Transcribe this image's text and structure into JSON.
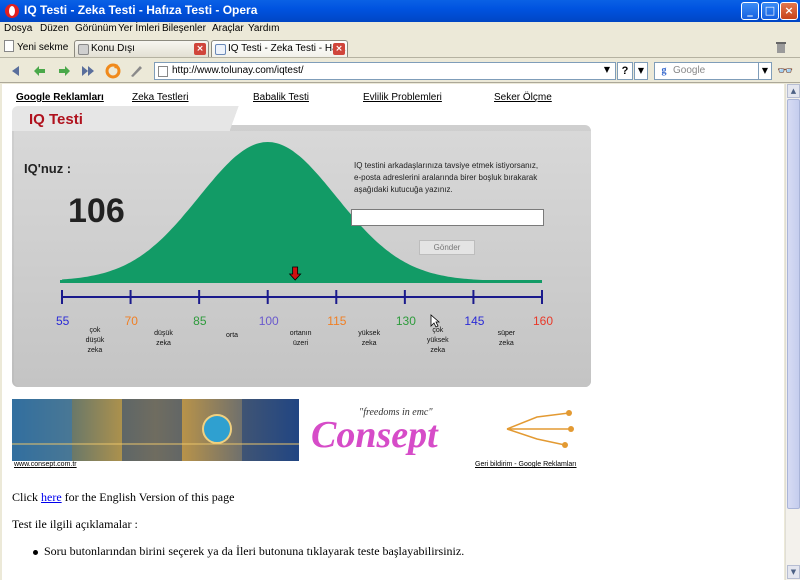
{
  "window": {
    "title": "IQ Testi - Zeka Testi - Hafıza Testi - Opera"
  },
  "menu": [
    "Dosya",
    "Düzen",
    "Görünüm",
    "Yer İmleri",
    "Bileşenler",
    "Araçlar",
    "Yardım"
  ],
  "tabs": {
    "new_tab": "Yeni sekme",
    "items": [
      {
        "label": "Konu Dışı"
      },
      {
        "label": "IQ Testi - Zeka Testi - Ha..."
      }
    ]
  },
  "address": {
    "url": "http://www.tolunay.com/iqtest/",
    "search_placeholder": "Google"
  },
  "page": {
    "nav_links": [
      "Google Reklamları",
      "Zeka Testleri",
      "Babalik Testi",
      "Evlilik Problemleri",
      "Seker Ölçme"
    ],
    "panel_title": "IQ Testi",
    "iq_label": "IQ'nuz :",
    "iq_score": "106",
    "invite_text": "IQ testini arkadaşlarınıza tavsiye etmek istiyorsanız, e-posta adreslerini aralarında birer boşluk bırakarak aşağıdaki kutucuğa yazınız.",
    "send_button": "Gönder",
    "scale": [
      {
        "value": "55",
        "color": "#2b2bd6",
        "caption": "çok\ndüşük\nzeka"
      },
      {
        "value": "70",
        "color": "#f07f24",
        "caption": "düşük\nzeka"
      },
      {
        "value": "85",
        "color": "#2e9b3c",
        "caption": "orta"
      },
      {
        "value": "100",
        "color": "#6a5acd",
        "caption": "ortanın\nüzeri"
      },
      {
        "value": "115",
        "color": "#f07f24",
        "caption": "yüksek\nzeka"
      },
      {
        "value": "130",
        "color": "#2e9b3c",
        "caption": "çok\nyüksek\nzeka"
      },
      {
        "value": "145",
        "color": "#2b2bd6",
        "caption": "süper\nzeka"
      },
      {
        "value": "160",
        "color": "#e8392a",
        "caption": ""
      }
    ],
    "marker_value": 106,
    "banner_right_tagline": "\"freedoms in emc\"",
    "banner_right_brand": "Consept",
    "banner_left_link": "www.consept.com.tr",
    "feedback_link": "Geri bildirim - Google Reklamları",
    "english_prefix": "Click ",
    "english_link": "here",
    "english_suffix": " for the English Version of this page",
    "explanations_heading": "Test ile ilgili açıklamalar :",
    "bullet_1": "Soru butonlarından birini seçerek ya da İleri butonuna tıklayarak teste başlayabilirsiniz."
  },
  "colors": {
    "bell_curve": "#129b66",
    "axis": "#1a1a8c",
    "marker": "#d01010"
  }
}
